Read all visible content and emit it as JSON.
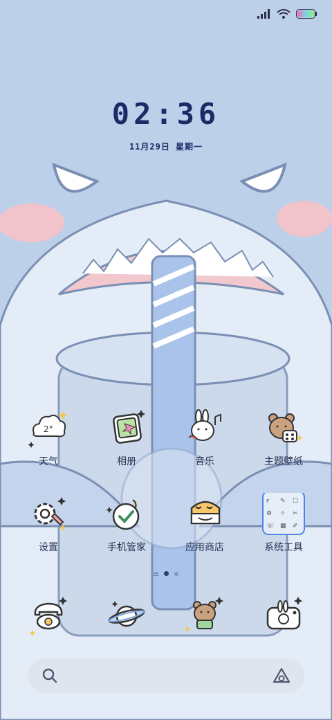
{
  "status_bar": {
    "icons": [
      "signal-icon",
      "wifi-icon",
      "battery-icon"
    ]
  },
  "lockscreen": {
    "time": "02:36",
    "date": "11月29日 星期一"
  },
  "apps_row1": [
    {
      "label": "天气",
      "icon": "weather-cloud-icon"
    },
    {
      "label": "相册",
      "icon": "gallery-icon"
    },
    {
      "label": "音乐",
      "icon": "music-bunny-icon"
    },
    {
      "label": "主题壁纸",
      "icon": "theme-bear-icon"
    }
  ],
  "apps_row2": [
    {
      "label": "设置",
      "icon": "gear-icon"
    },
    {
      "label": "手机管家",
      "icon": "security-shield-icon"
    },
    {
      "label": "应用商店",
      "icon": "app-store-icon"
    },
    {
      "label": "系统工具",
      "icon": "system-tools-folder-icon"
    }
  ],
  "dock": [
    {
      "icon": "phone-icon"
    },
    {
      "icon": "browser-planet-icon"
    },
    {
      "icon": "messages-bear-icon"
    },
    {
      "icon": "camera-bunny-icon"
    }
  ],
  "page_indicator": {
    "pages": 2,
    "active": 1
  },
  "search": {
    "icons": [
      "search-icon",
      "assistant-icon"
    ]
  },
  "colors": {
    "background": "#bcd0ea",
    "clock": "#1e2a66",
    "label": "#2a3255"
  }
}
